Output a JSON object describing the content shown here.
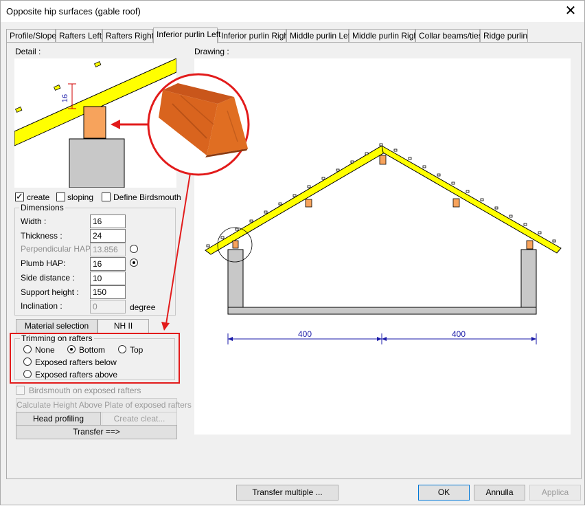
{
  "window": {
    "title": "Opposite hip surfaces (gable roof)"
  },
  "tabs": [
    {
      "label": "Profile/Slope"
    },
    {
      "label": "Rafters Left"
    },
    {
      "label": "Rafters Right"
    },
    {
      "label": "Inferior purlin Left"
    },
    {
      "label": "Inferior purlin Right"
    },
    {
      "label": "Middle purlin Left"
    },
    {
      "label": "Middle purlin Right"
    },
    {
      "label": "Collar beams/ties"
    },
    {
      "label": "Ridge purlin"
    }
  ],
  "active_tab": "Inferior purlin Left",
  "detail": {
    "label": "Detail :",
    "dimension_value": "16"
  },
  "drawing": {
    "label": "Drawing :",
    "dim_left": "400",
    "dim_right": "400"
  },
  "options": {
    "create": {
      "label": "create",
      "checked": true
    },
    "sloping": {
      "label": "sloping",
      "checked": false
    },
    "birdsmouth": {
      "label": "Define Birdsmouth",
      "checked": false
    }
  },
  "dimensions": {
    "title": "Dimensions",
    "width": {
      "label": "Width :",
      "value": "16"
    },
    "thickness": {
      "label": "Thickness :",
      "value": "24"
    },
    "perp_hap": {
      "label": "Perpendicular HAP:",
      "value": "13.856"
    },
    "plumb_hap": {
      "label": "Plumb HAP:",
      "value": "16"
    },
    "side_distance": {
      "label": "Side distance :",
      "value": "10"
    },
    "support_height": {
      "label": "Support height :",
      "value": "150"
    },
    "inclination": {
      "label": "Inclination :",
      "value": "0",
      "unit": "degree"
    }
  },
  "material": {
    "button": "Material selection",
    "value": "NH II"
  },
  "trimming": {
    "title": "Trimming on rafters",
    "none": "None",
    "bottom": "Bottom",
    "top": "Top",
    "below": "Exposed rafters below",
    "above": "Exposed rafters above",
    "selected": "Bottom"
  },
  "extra": {
    "birdsmouth_exposed": "Birdsmouth on exposed rafters",
    "calc_hap": "Calculate Height Above Plate of exposed rafters",
    "head_profiling": "Head profiling",
    "create_cleat": "Create cleat...",
    "transfer": "Transfer ==>"
  },
  "footer": {
    "transfer_multiple": "Transfer multiple ...",
    "ok": "OK",
    "cancel": "Annulla",
    "apply": "Applica"
  },
  "colors": {
    "rafter": "#ffff00",
    "purlin": "#f7a35c",
    "wall": "#c8c8c8",
    "dimension": "#1a1aa8",
    "highlight": "#e21b1b"
  }
}
